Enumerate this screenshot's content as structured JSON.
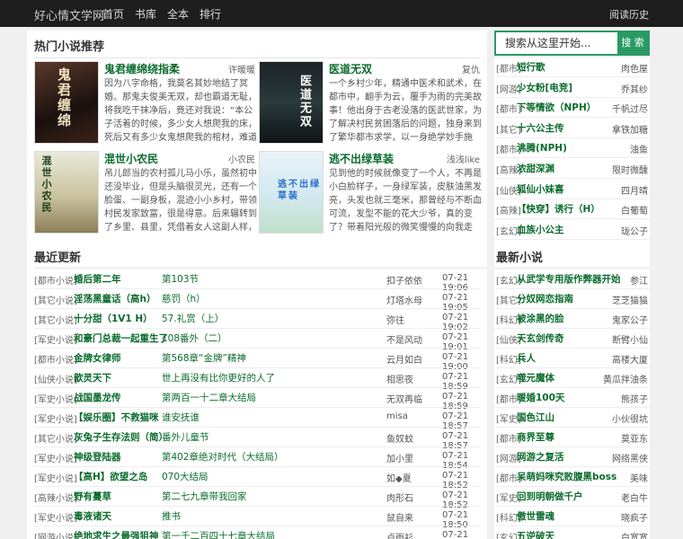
{
  "site": {
    "brand": "好心情文学网",
    "nav": [
      "首页",
      "书库",
      "全本",
      "排行"
    ],
    "history": "阅读历史"
  },
  "search": {
    "placeholder": "搜索从这里开始...",
    "button": "搜 索"
  },
  "hot": {
    "title": "热门小说推荐",
    "books": [
      {
        "name": "鬼君缠绵绕指柔",
        "author": "许暖暖",
        "cover_text": "鬼君缠绵",
        "desc": "因为八字命格，我莫名其妙地结了冥婚。那鬼夫俊美无双，却也霸道无耻，将我吃干抹净后，竟还对我说：“本公子活着的时候，多少女人想爬我的床，死后又有多少女鬼想爬我的棺材，难道你对我就没有一点心思？”我坚决抵"
      },
      {
        "name": "医道无双",
        "author": "复仇",
        "cover_text": "医道无双",
        "desc": "一个乡村少年，精通中医术和武术，在都市中，翻手为云，覆手为雨的完美故事！他出身于古老没落的医武世家，为了解决村民贫困落后的问题，独身来到了繁华都市求学，以一身绝学妙手施春，医治病人无数！如今，中医"
      },
      {
        "name": "混世小农民",
        "author": "小农民",
        "cover_text": "混世小农民",
        "desc": "吊儿郎当的农村孤儿马小乐，虽然初中还没毕业，但是头脑很灵光，还有一个脸蛋、一副身板，混迹小小乡村，带领村民发家致富，很是得意。后来辗转到了乡里、县里，凭借着女人这副人样，官是越做越大，日子是越来越"
      },
      {
        "name": "逃不出绿草装",
        "author": "浅浅like",
        "cover_text": "逃不出绿草装",
        "desc": "见到他的时候就像变了一个人，不再是小白脸样子，一身绿军装，皮肤油黑发亮，头发也就三毫米，那曾经与不断血可流，发型不能的花大少爷，真的变了？带着阳光般的微笑慢慢的向我走来……"
      }
    ]
  },
  "side_top": [
    {
      "cat": "[都市]",
      "title": "短行歌",
      "author": "肉色屋"
    },
    {
      "cat": "[网游]",
      "title": "少女粉[电竞]",
      "author": "乔其纱"
    },
    {
      "cat": "[都市]",
      "title": "下等情欲（NPH）",
      "author": "千帆过尽"
    },
    {
      "cat": "[其它]",
      "title": "十六公主传",
      "author": "拿铁加糖"
    },
    {
      "cat": "[都市]",
      "title": "沸腾(NPH)",
      "author": "油鱼"
    },
    {
      "cat": "[高辣]",
      "title": "浓甜深渊",
      "author": "限时微醺"
    },
    {
      "cat": "[仙侠]",
      "title": "狐仙小妹喜",
      "author": "四月晴"
    },
    {
      "cat": "[高辣]",
      "title": "【快穿】诱行（H）",
      "author": "白葡萄"
    },
    {
      "cat": "[玄幻]",
      "title": "血族小公主",
      "author": "珑公子"
    }
  ],
  "latest": {
    "title": "最近更新",
    "rows": [
      {
        "cat": "[都市小说]",
        "title": "婚后第二年",
        "chapter": "第103节",
        "author": "扣子依依",
        "time": "07-21 19:06"
      },
      {
        "cat": "[其它小说]",
        "title": "淫荡黑童话（高h）",
        "chapter": "慈罚（h）",
        "author": "灯塔水母",
        "time": "07-21 19:05"
      },
      {
        "cat": "[其它小说]",
        "title": "十分甜（1V1 H）",
        "chapter": "57.礼赏（上）",
        "author": "弥往",
        "time": "07-21 19:02"
      },
      {
        "cat": "[军史小说]",
        "title": "和豪门总裁一起重生了",
        "chapter": "108番外（二）",
        "author": "不是风动",
        "time": "07-21 19:01"
      },
      {
        "cat": "[都市小说]",
        "title": "金牌女律师",
        "chapter": "第568章“金牌”精神",
        "author": "云月如白",
        "time": "07-21 19:00"
      },
      {
        "cat": "[仙侠小说]",
        "title": "歆灵天下",
        "chapter": "世上再没有比你更好的人了",
        "author": "相思夜",
        "time": "07-21 18:59"
      },
      {
        "cat": "[军史小说]",
        "title": "战国墨龙传",
        "chapter": "第两百一十二章大结局",
        "author": "无双再临",
        "time": "07-21 18:59"
      },
      {
        "cat": "[军史小说]",
        "title": "【娱乐圈】不救猫咪",
        "chapter": "谁安抚谁",
        "author": "misa",
        "time": "07-21 18:57"
      },
      {
        "cat": "[其它小说]",
        "title": "灰兔子生存法则（简）",
        "chapter": "番外儿童节",
        "author": "鱼奴蚊",
        "time": "07-21 18:57"
      },
      {
        "cat": "[军史小说]",
        "title": "神级登陆器",
        "chapter": "第402章绝对时代（大结局）",
        "author": "加小里",
        "time": "07-21 18:54"
      },
      {
        "cat": "[军史小说]",
        "title": "【高H】欲望之岛",
        "chapter": "070大结局",
        "author": "如◆夏",
        "time": "07-21 18:52"
      },
      {
        "cat": "[高辣小说]",
        "title": "野有蔓草",
        "chapter": "第二七九章带我回家",
        "author": "肉形石",
        "time": "07-21 18:52"
      },
      {
        "cat": "[军史小说]",
        "title": "毒液诸天",
        "chapter": "推书",
        "author": "鼠自来",
        "time": "07-21 18:50"
      },
      {
        "cat": "[网游小说]",
        "title": "绝地求生之最强狙神",
        "chapter": "第一千二百四十七章大结局",
        "author": "卢雨衫",
        "time": "07-21 18:43"
      }
    ]
  },
  "newest": {
    "title": "最新小说",
    "rows": [
      {
        "cat": "[玄幻]",
        "title": "从武学专用版作弊器开始",
        "author": "参江"
      },
      {
        "cat": "[其它]",
        "title": "分奴网恋指南",
        "author": "芝芝猫猫"
      },
      {
        "cat": "[科幻]",
        "title": "被涂黑的脸",
        "author": "鬼家公子"
      },
      {
        "cat": "[仙侠]",
        "title": "天玄剑传奇",
        "author": "断臂小仙"
      },
      {
        "cat": "[科幻]",
        "title": "兵人",
        "author": "高楼大厦"
      },
      {
        "cat": "[玄幻]",
        "title": "噬元魔体",
        "author": "黄瓜拌油条"
      },
      {
        "cat": "[都市]",
        "title": "暖婚100天",
        "author": "熊孩子"
      },
      {
        "cat": "[军史]",
        "title": "国色江山",
        "author": "小伙很坑"
      },
      {
        "cat": "[都市]",
        "title": "商界至尊",
        "author": "莫亚东"
      },
      {
        "cat": "[网游]",
        "title": "网游之复活",
        "author": "网络黑侠"
      },
      {
        "cat": "[都市]",
        "title": "呆萌妈咪究败腹黑boss",
        "author": "美味"
      },
      {
        "cat": "[军史]",
        "title": "回到明朝做千户",
        "author": "老白牛"
      },
      {
        "cat": "[科幻]",
        "title": "傲世雷魂",
        "author": "晓疯子"
      },
      {
        "cat": "[玄幻]",
        "title": "五逆破天",
        "author": "白宽宽"
      }
    ]
  }
}
